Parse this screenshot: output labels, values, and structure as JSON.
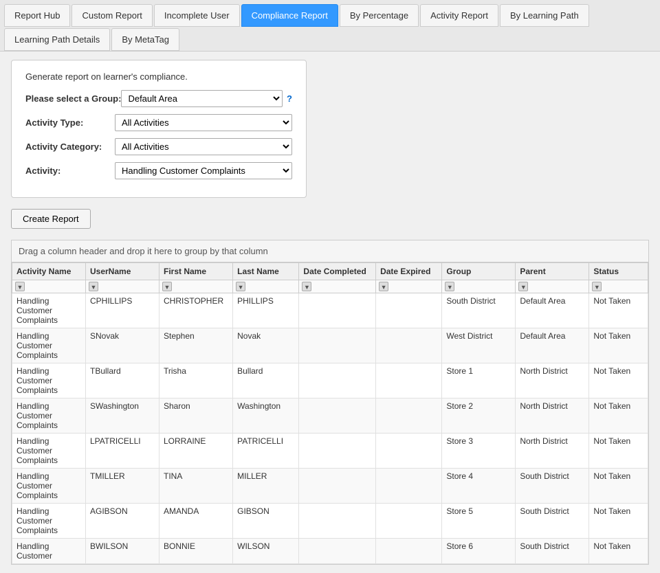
{
  "nav": {
    "tabs": [
      {
        "id": "report-hub",
        "label": "Report Hub",
        "active": false
      },
      {
        "id": "custom-report",
        "label": "Custom Report",
        "active": false
      },
      {
        "id": "incomplete-user",
        "label": "Incomplete User",
        "active": false
      },
      {
        "id": "compliance-report",
        "label": "Compliance Report",
        "active": true
      },
      {
        "id": "by-percentage",
        "label": "By Percentage",
        "active": false
      },
      {
        "id": "activity-report",
        "label": "Activity Report",
        "active": false
      },
      {
        "id": "by-learning-path",
        "label": "By Learning Path",
        "active": false
      },
      {
        "id": "learning-path-details",
        "label": "Learning Path Details",
        "active": false
      },
      {
        "id": "by-metatag",
        "label": "By MetaTag",
        "active": false
      }
    ]
  },
  "form": {
    "description": "Generate report on learner's compliance.",
    "group_label": "Please select a Group:",
    "group_value": "Default Area",
    "group_options": [
      "Default Area"
    ],
    "help_link": "?",
    "activity_type_label": "Activity Type:",
    "activity_type_value": "All Activities",
    "activity_type_options": [
      "All Activities"
    ],
    "activity_category_label": "Activity Category:",
    "activity_category_value": "All Activities",
    "activity_category_options": [
      "All Activities"
    ],
    "activity_label": "Activity:",
    "activity_value": "Handling Customer Complaints",
    "activity_options": [
      "Handling Customer Complaints"
    ]
  },
  "create_report_label": "Create Report",
  "table": {
    "drag_text": "Drag a column header and drop it here to group by that column",
    "columns": [
      {
        "id": "activity-name",
        "label": "Activity Name"
      },
      {
        "id": "username",
        "label": "UserName"
      },
      {
        "id": "first-name",
        "label": "First Name"
      },
      {
        "id": "last-name",
        "label": "Last Name"
      },
      {
        "id": "date-completed",
        "label": "Date Completed"
      },
      {
        "id": "date-expired",
        "label": "Date Expired"
      },
      {
        "id": "group",
        "label": "Group"
      },
      {
        "id": "parent",
        "label": "Parent"
      },
      {
        "id": "status",
        "label": "Status"
      }
    ],
    "rows": [
      {
        "activity": "Handling Customer Complaints",
        "username": "CPHILLIPS",
        "firstname": "CHRISTOPHER",
        "lastname": "PHILLIPS",
        "datecompleted": "",
        "dateexpired": "",
        "group": "South District",
        "parent": "Default Area",
        "status": "Not Taken"
      },
      {
        "activity": "Handling Customer Complaints",
        "username": "SNovak",
        "firstname": "Stephen",
        "lastname": "Novak",
        "datecompleted": "",
        "dateexpired": "",
        "group": "West District",
        "parent": "Default Area",
        "status": "Not Taken"
      },
      {
        "activity": "Handling Customer Complaints",
        "username": "TBullard",
        "firstname": "Trisha",
        "lastname": "Bullard",
        "datecompleted": "",
        "dateexpired": "",
        "group": "Store 1",
        "parent": "North District",
        "status": "Not Taken"
      },
      {
        "activity": "Handling Customer Complaints",
        "username": "SWashington",
        "firstname": "Sharon",
        "lastname": "Washington",
        "datecompleted": "",
        "dateexpired": "",
        "group": "Store 2",
        "parent": "North District",
        "status": "Not Taken"
      },
      {
        "activity": "Handling Customer Complaints",
        "username": "LPATRICELLI",
        "firstname": "LORRAINE",
        "lastname": "PATRICELLI",
        "datecompleted": "",
        "dateexpired": "",
        "group": "Store 3",
        "parent": "North District",
        "status": "Not Taken"
      },
      {
        "activity": "Handling Customer Complaints",
        "username": "TMILLER",
        "firstname": "TINA",
        "lastname": "MILLER",
        "datecompleted": "",
        "dateexpired": "",
        "group": "Store 4",
        "parent": "South District",
        "status": "Not Taken"
      },
      {
        "activity": "Handling Customer Complaints",
        "username": "AGIBSON",
        "firstname": "AMANDA",
        "lastname": "GIBSON",
        "datecompleted": "",
        "dateexpired": "",
        "group": "Store 5",
        "parent": "South District",
        "status": "Not Taken"
      },
      {
        "activity": "Handling Customer",
        "username": "BWILSON",
        "firstname": "BONNIE",
        "lastname": "WILSON",
        "datecompleted": "",
        "dateexpired": "",
        "group": "Store 6",
        "parent": "South District",
        "status": "Not Taken"
      }
    ]
  }
}
